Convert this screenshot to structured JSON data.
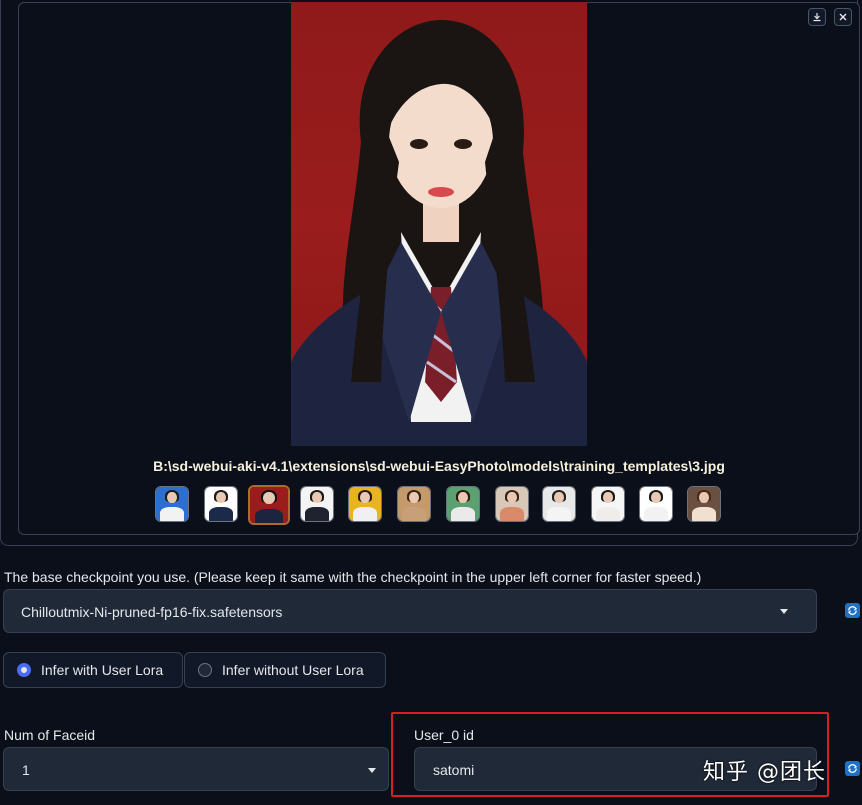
{
  "gallery": {
    "download_icon": "download-icon",
    "close_icon": "close-icon",
    "caption": "B:\\sd-webui-aki-v4.1\\extensions\\sd-webui-EasyPhoto\\models\\training_templates\\3.jpg",
    "thumbnails": [
      {
        "bg": "#2d6fd0",
        "hair": "#1b1b1b",
        "body": "#f2f2f2"
      },
      {
        "bg": "#ffffff",
        "hair": "#1b1b1b",
        "body": "#1c2a4a"
      },
      {
        "bg": "#9a1c1c",
        "hair": "#141414",
        "body": "#1d2440",
        "selected": true
      },
      {
        "bg": "#f4f4f4",
        "hair": "#1a1a1a",
        "body": "#1f2330"
      },
      {
        "bg": "#e8b520",
        "hair": "#2a1a10",
        "body": "#f0f0f0"
      },
      {
        "bg": "#c59a6a",
        "hair": "#3a2414",
        "body": "#c7a07a"
      },
      {
        "bg": "#5aa070",
        "hair": "#2a1a10",
        "body": "#eaeaea"
      },
      {
        "bg": "#d8c8b8",
        "hair": "#3a2414",
        "body": "#d98a6a"
      },
      {
        "bg": "#e8e8e8",
        "hair": "#222222",
        "body": "#f4f4f4"
      },
      {
        "bg": "#f6f6f6",
        "hair": "#1b1b1b",
        "body": "#f0ecea"
      },
      {
        "bg": "#ffffff",
        "hair": "#1b1b1b",
        "body": "#f2f2f2"
      },
      {
        "bg": "#6a5040",
        "hair": "#4a2a18",
        "body": "#f1e0d0"
      }
    ]
  },
  "checkpoint": {
    "label": "The base checkpoint you use. (Please keep it same with the checkpoint in the upper left corner for faster speed.)",
    "value": "Chilloutmix-Ni-pruned-fp16-fix.safetensors"
  },
  "lora_mode": {
    "options": [
      "Infer with User Lora",
      "Infer without User Lora"
    ],
    "selected": "Infer with User Lora"
  },
  "faceid": {
    "label": "Num of Faceid",
    "value": "1"
  },
  "user_id": {
    "label": "User_0 id",
    "value": "satomi"
  },
  "watermark": "知乎 @团长",
  "colors": {
    "background": "#0b0f19",
    "panel": "#1f2937",
    "accent_blue": "#1d72c6",
    "highlight_red": "#d42020",
    "radio_on": "#4a6cf0"
  }
}
